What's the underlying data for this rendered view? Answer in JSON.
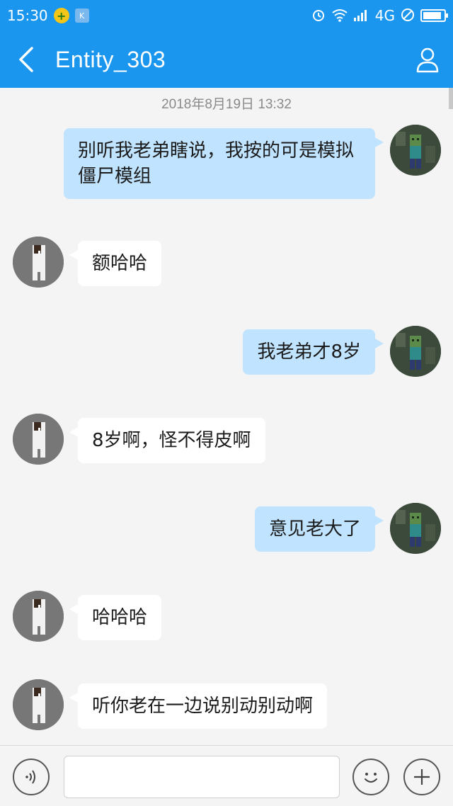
{
  "status_bar": {
    "time": "15:30",
    "badge_k": "K",
    "network": "4G",
    "battery_level": 0.9
  },
  "header": {
    "title": "Entity_303"
  },
  "chat": {
    "timestamp": "2018年8月19日 13:32",
    "messages": [
      {
        "side": "out",
        "text": "别听我老弟瞎说，我按的可是模拟僵尸模组"
      },
      {
        "side": "in",
        "text": "额哈哈"
      },
      {
        "side": "out",
        "text": "我老弟才8岁"
      },
      {
        "side": "in",
        "text": "8岁啊，怪不得皮啊"
      },
      {
        "side": "out",
        "text": "意见老大了"
      },
      {
        "side": "in",
        "text": "哈哈哈"
      },
      {
        "side": "in",
        "text": "听你老在一边说别动别动啊"
      }
    ]
  },
  "input_bar": {
    "text_value": ""
  },
  "colors": {
    "accent": "#1a96ef",
    "outgoing_bubble": "#c0e3ff",
    "incoming_bubble": "#ffffff",
    "background": "#f4f4f4"
  }
}
